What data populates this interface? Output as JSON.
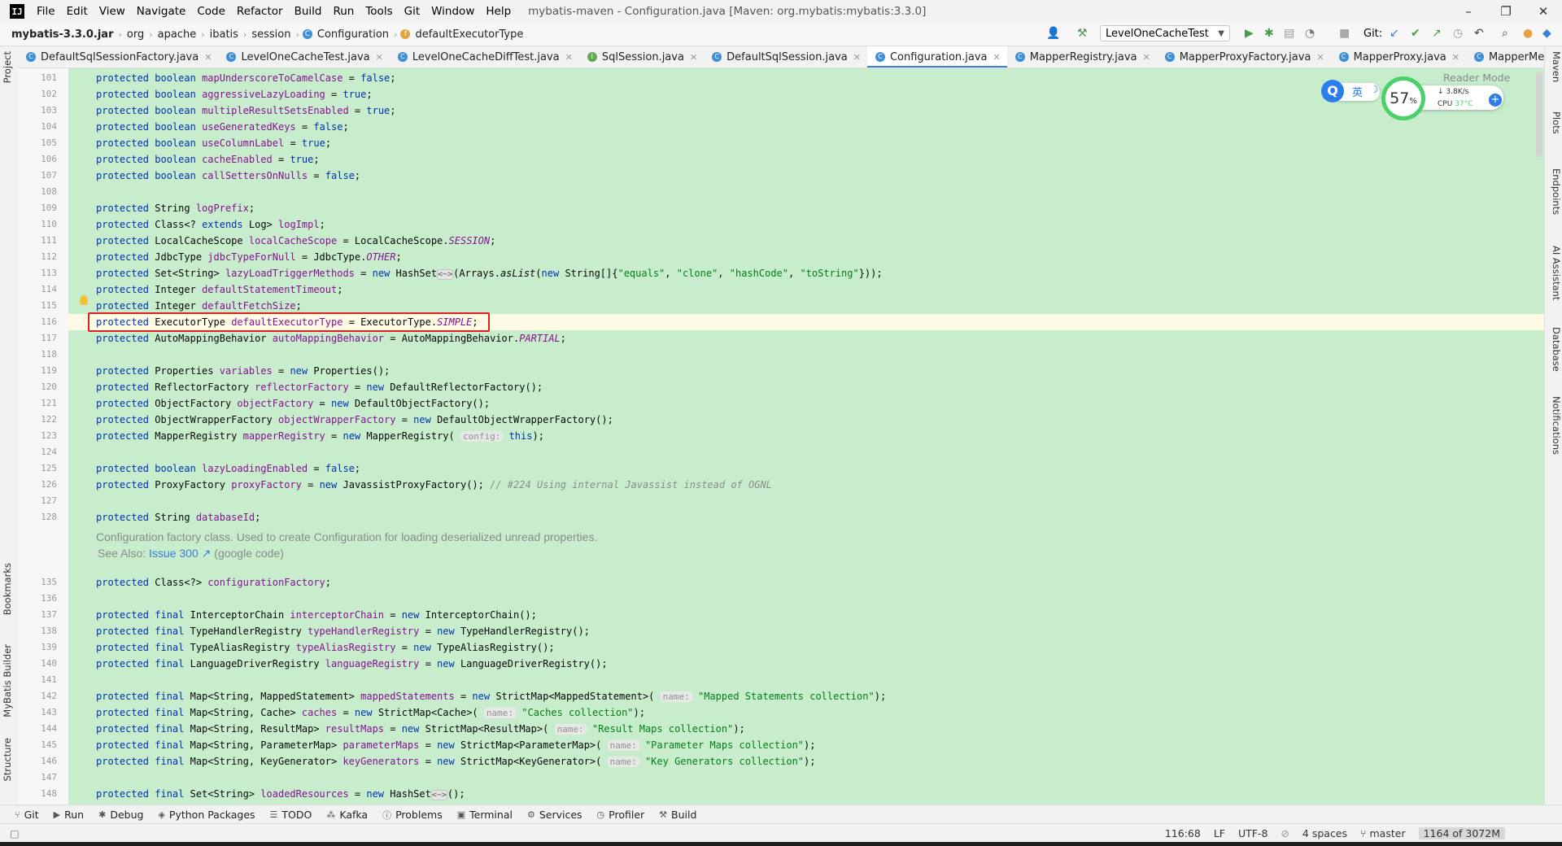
{
  "menubar": {
    "logo": "IJ",
    "items": [
      "File",
      "Edit",
      "View",
      "Navigate",
      "Code",
      "Refactor",
      "Build",
      "Run",
      "Tools",
      "Git",
      "Window",
      "Help"
    ],
    "window_title": "mybatis-maven - Configuration.java [Maven: org.mybatis:mybatis:3.3.0]",
    "controls": [
      "–",
      "❐",
      "✕"
    ]
  },
  "navbar": {
    "breadcrumbs": [
      "mybatis-3.3.0.jar",
      "org",
      "apache",
      "ibatis",
      "session",
      "Configuration",
      "defaultExecutorType"
    ],
    "run_config": "LevelOneCacheTest",
    "git_label": "Git:"
  },
  "tabs": [
    {
      "label": "DefaultSqlSessionFactory.java",
      "icon": "class"
    },
    {
      "label": "LevelOneCacheTest.java",
      "icon": "class"
    },
    {
      "label": "LevelOneCacheDiffTest.java",
      "icon": "class"
    },
    {
      "label": "SqlSession.java",
      "icon": "interface"
    },
    {
      "label": "DefaultSqlSession.java",
      "icon": "class"
    },
    {
      "label": "Configuration.java",
      "icon": "class",
      "active": true
    },
    {
      "label": "MapperRegistry.java",
      "icon": "class"
    },
    {
      "label": "MapperProxyFactory.java",
      "icon": "class"
    },
    {
      "label": "MapperProxy.java",
      "icon": "class"
    },
    {
      "label": "MapperMethod.java",
      "icon": "class"
    }
  ],
  "left_stripe": [
    "Project",
    "Bookmarks",
    "MyBatis Builder",
    "Structure"
  ],
  "right_stripe": [
    "Maven",
    "Plots",
    "Endpoints",
    "AI Assistant",
    "Database",
    "Notifications"
  ],
  "reader_mode": "Reader Mode",
  "widget": {
    "q": "Q",
    "lang": "英",
    "moon": "☽",
    "percent": "57",
    "percent_sign": "%",
    "speed": "↓ 3.8K/s",
    "cpu_label": "CPU",
    "cpu_temp": "37°C",
    "plus": "+"
  },
  "doc_comment": {
    "text": "Configuration factory class. Used to create Configuration for loading deserialized unread properties.",
    "see_also_prefix": "See Also:",
    "link": "Issue 300 ↗",
    "suffix": "(google code)"
  },
  "code_lines": [
    {
      "n": "101",
      "html": "<span class='kw'>protected boolean</span> <span class='fld'>mapUnderscoreToCamelCase</span> = <span class='kw'>false</span>;"
    },
    {
      "n": "102",
      "html": "<span class='kw'>protected boolean</span> <span class='fld'>aggressiveLazyLoading</span> = <span class='kw'>true</span>;"
    },
    {
      "n": "103",
      "html": "<span class='kw'>protected boolean</span> <span class='fld'>multipleResultSetsEnabled</span> = <span class='kw'>true</span>;"
    },
    {
      "n": "104",
      "html": "<span class='kw'>protected boolean</span> <span class='fld'>useGeneratedKeys</span> = <span class='kw'>false</span>;"
    },
    {
      "n": "105",
      "html": "<span class='kw'>protected boolean</span> <span class='fld'>useColumnLabel</span> = <span class='kw'>true</span>;"
    },
    {
      "n": "106",
      "html": "<span class='kw'>protected boolean</span> <span class='fld'>cacheEnabled</span> = <span class='kw'>true</span>;"
    },
    {
      "n": "107",
      "html": "<span class='kw'>protected boolean</span> <span class='fld'>callSettersOnNulls</span> = <span class='kw'>false</span>;"
    },
    {
      "n": "108",
      "html": ""
    },
    {
      "n": "109",
      "html": "<span class='kw'>protected</span> String <span class='fld'>logPrefix</span>;"
    },
    {
      "n": "110",
      "html": "<span class='kw'>protected</span> Class&lt;? <span class='kw'>extends</span> Log&gt; <span class='fld'>logImpl</span>;"
    },
    {
      "n": "111",
      "html": "<span class='kw'>protected</span> LocalCacheScope <span class='fld'>localCacheScope</span> = LocalCacheScope.<span class='it'>SESSION</span>;"
    },
    {
      "n": "112",
      "html": "<span class='kw'>protected</span> JdbcType <span class='fld'>jdbcTypeForNull</span> = JdbcType.<span class='it'>OTHER</span>;"
    },
    {
      "n": "113",
      "html": "<span class='kw'>protected</span> Set&lt;String&gt; <span class='fld'>lazyLoadTriggerMethods</span> = <span class='kw'>new</span> HashSet<span class='fold'>&lt;~&gt;</span>(Arrays.<span class='sm'>asList</span>(<span class='kw'>new</span> String[]{<span class='str'>\"equals\"</span>, <span class='str'>\"clone\"</span>, <span class='str'>\"hashCode\"</span>, <span class='str'>\"toString\"</span>}));"
    },
    {
      "n": "114",
      "html": "<span class='kw'>protected</span> Integer <span class='fld'>defaultStatementTimeout</span>;"
    },
    {
      "n": "115",
      "html": "<span class='kw'>protected</span> Integer <span class='fld'>defaultFetchSize</span>;"
    },
    {
      "n": "116",
      "html": "<span class='kw'>protected</span> ExecutorType <span class='fld'>defaultExecutorType</span> = ExecutorType.<span class='it'>SIMPLE</span>;",
      "current": true
    },
    {
      "n": "117",
      "html": "<span class='kw'>protected</span> AutoMappingBehavior <span class='fld'>autoMappingBehavior</span> = AutoMappingBehavior.<span class='it'>PARTIAL</span>;"
    },
    {
      "n": "118",
      "html": ""
    },
    {
      "n": "119",
      "html": "<span class='kw'>protected</span> Properties <span class='fld'>variables</span> = <span class='kw'>new</span> Properties();"
    },
    {
      "n": "120",
      "html": "<span class='kw'>protected</span> ReflectorFactory <span class='fld'>reflectorFactory</span> = <span class='kw'>new</span> DefaultReflectorFactory();"
    },
    {
      "n": "121",
      "html": "<span class='kw'>protected</span> ObjectFactory <span class='fld'>objectFactory</span> = <span class='kw'>new</span> DefaultObjectFactory();"
    },
    {
      "n": "122",
      "html": "<span class='kw'>protected</span> ObjectWrapperFactory <span class='fld'>objectWrapperFactory</span> = <span class='kw'>new</span> DefaultObjectWrapperFactory();"
    },
    {
      "n": "123",
      "html": "<span class='kw'>protected</span> MapperRegistry <span class='fld'>mapperRegistry</span> = <span class='kw'>new</span> MapperRegistry( <span class='hint'>config:</span> <span class='kw'>this</span>);"
    },
    {
      "n": "124",
      "html": ""
    },
    {
      "n": "125",
      "html": "<span class='kw'>protected boolean</span> <span class='fld'>lazyLoadingEnabled</span> = <span class='kw'>false</span>;"
    },
    {
      "n": "126",
      "html": "<span class='kw'>protected</span> ProxyFactory <span class='fld'>proxyFactory</span> = <span class='kw'>new</span> JavassistProxyFactory(); <span class='cm'>// #224 Using internal Javassist instead of OGNL</span>"
    },
    {
      "n": "127",
      "html": ""
    },
    {
      "n": "128",
      "html": "<span class='kw'>protected</span> String <span class='fld'>databaseId</span>;"
    },
    {
      "n": "135",
      "html": "<span class='kw'>protected</span> Class&lt;?&gt; <span class='fld'>configurationFactory</span>;"
    },
    {
      "n": "136",
      "html": ""
    },
    {
      "n": "137",
      "html": "<span class='kw'>protected final</span> InterceptorChain <span class='fld'>interceptorChain</span> = <span class='kw'>new</span> InterceptorChain();"
    },
    {
      "n": "138",
      "html": "<span class='kw'>protected final</span> TypeHandlerRegistry <span class='fld'>typeHandlerRegistry</span> = <span class='kw'>new</span> TypeHandlerRegistry();"
    },
    {
      "n": "139",
      "html": "<span class='kw'>protected final</span> TypeAliasRegistry <span class='fld'>typeAliasRegistry</span> = <span class='kw'>new</span> TypeAliasRegistry();"
    },
    {
      "n": "140",
      "html": "<span class='kw'>protected final</span> LanguageDriverRegistry <span class='fld'>languageRegistry</span> = <span class='kw'>new</span> LanguageDriverRegistry();"
    },
    {
      "n": "141",
      "html": ""
    },
    {
      "n": "142",
      "html": "<span class='kw'>protected final</span> Map&lt;String, MappedStatement&gt; <span class='fld'>mappedStatements</span> = <span class='kw'>new</span> StrictMap&lt;MappedStatement&gt;( <span class='hint'>name:</span> <span class='str'>\"Mapped Statements collection\"</span>);"
    },
    {
      "n": "143",
      "html": "<span class='kw'>protected final</span> Map&lt;String, Cache&gt; <span class='fld'>caches</span> = <span class='kw'>new</span> StrictMap&lt;Cache&gt;( <span class='hint'>name:</span> <span class='str'>\"Caches collection\"</span>);"
    },
    {
      "n": "144",
      "html": "<span class='kw'>protected final</span> Map&lt;String, ResultMap&gt; <span class='fld'>resultMaps</span> = <span class='kw'>new</span> StrictMap&lt;ResultMap&gt;( <span class='hint'>name:</span> <span class='str'>\"Result Maps collection\"</span>);"
    },
    {
      "n": "145",
      "html": "<span class='kw'>protected final</span> Map&lt;String, ParameterMap&gt; <span class='fld'>parameterMaps</span> = <span class='kw'>new</span> StrictMap&lt;ParameterMap&gt;( <span class='hint'>name:</span> <span class='str'>\"Parameter Maps collection\"</span>);"
    },
    {
      "n": "146",
      "html": "<span class='kw'>protected final</span> Map&lt;String, KeyGenerator&gt; <span class='fld'>keyGenerators</span> = <span class='kw'>new</span> StrictMap&lt;KeyGenerator&gt;( <span class='hint'>name:</span> <span class='str'>\"Key Generators collection\"</span>);"
    },
    {
      "n": "147",
      "html": ""
    },
    {
      "n": "148",
      "html": "<span class='kw'>protected final</span> Set&lt;String&gt; <span class='fld'>loadedResources</span> = <span class='kw'>new</span> HashSet<span class='fold'>&lt;~&gt;</span>();"
    }
  ],
  "bottom_tools": [
    {
      "label": "Git",
      "icon": "git-icon",
      "glyph": "⑂"
    },
    {
      "label": "Run",
      "icon": "run-icon",
      "glyph": "▶"
    },
    {
      "label": "Debug",
      "icon": "debug-icon",
      "glyph": "✱"
    },
    {
      "label": "Python Packages",
      "icon": "packages-icon",
      "glyph": "◈"
    },
    {
      "label": "TODO",
      "icon": "todo-icon",
      "glyph": "☰"
    },
    {
      "label": "Kafka",
      "icon": "kafka-icon",
      "glyph": "⁂"
    },
    {
      "label": "Problems",
      "icon": "problems-icon",
      "glyph": "ⓘ"
    },
    {
      "label": "Terminal",
      "icon": "terminal-icon",
      "glyph": "▣"
    },
    {
      "label": "Services",
      "icon": "services-icon",
      "glyph": "⚙"
    },
    {
      "label": "Profiler",
      "icon": "profiler-icon",
      "glyph": "◷"
    },
    {
      "label": "Build",
      "icon": "build-icon",
      "glyph": "⚒"
    }
  ],
  "status": {
    "position": "116:68",
    "line_sep": "LF",
    "encoding": "UTF-8",
    "indent": "4 spaces",
    "branch": "master",
    "memory": "1164 of 3072M"
  }
}
